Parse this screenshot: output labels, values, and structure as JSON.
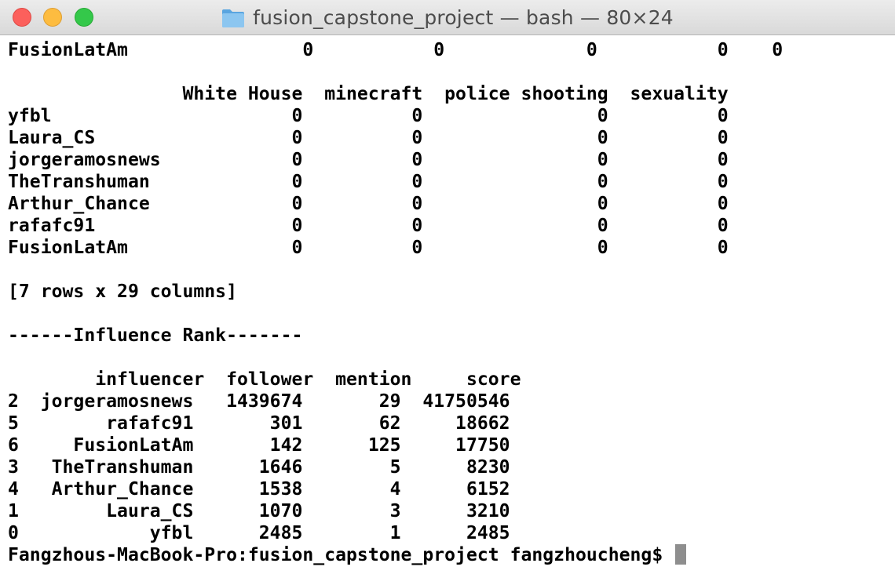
{
  "window": {
    "title": "fusion_capstone_project — bash — 80×24",
    "folder_icon": "folder-icon"
  },
  "terminal": {
    "lines": [
      "FusionLatAm                0           0             0           0    0",
      "",
      "                White House  minecraft  police shooting  sexuality",
      "yfbl                      0          0                0          0",
      "Laura_CS                  0          0                0          0",
      "jorgeramosnews            0          0                0          0",
      "TheTranshuman             0          0                0          0",
      "Arthur_Chance             0          0                0          0",
      "rafafc91                  0          0                0          0",
      "FusionLatAm               0          0                0          0",
      "",
      "[7 rows x 29 columns]",
      "",
      "------Influence Rank-------",
      "",
      "        influencer  follower  mention     score",
      "2  jorgeramosnews   1439674       29  41750546",
      "5        rafafc91       301       62     18662",
      "6     FusionLatAm       142      125     17750",
      "3   TheTranshuman      1646        5      8230",
      "4   Arthur_Chance      1538        4      6152",
      "1        Laura_CS      1070        3      3210",
      "0            yfbl      2485        1      2485"
    ],
    "prompt": "Fangzhous-MacBook-Pro:fusion_capstone_project fangzhoucheng$ "
  },
  "colors": {
    "close": "#fc605c",
    "minimize": "#fdbc40",
    "zoom": "#34c84a",
    "folder": "#7bb8e8",
    "cursor": "#8e8e8e"
  }
}
